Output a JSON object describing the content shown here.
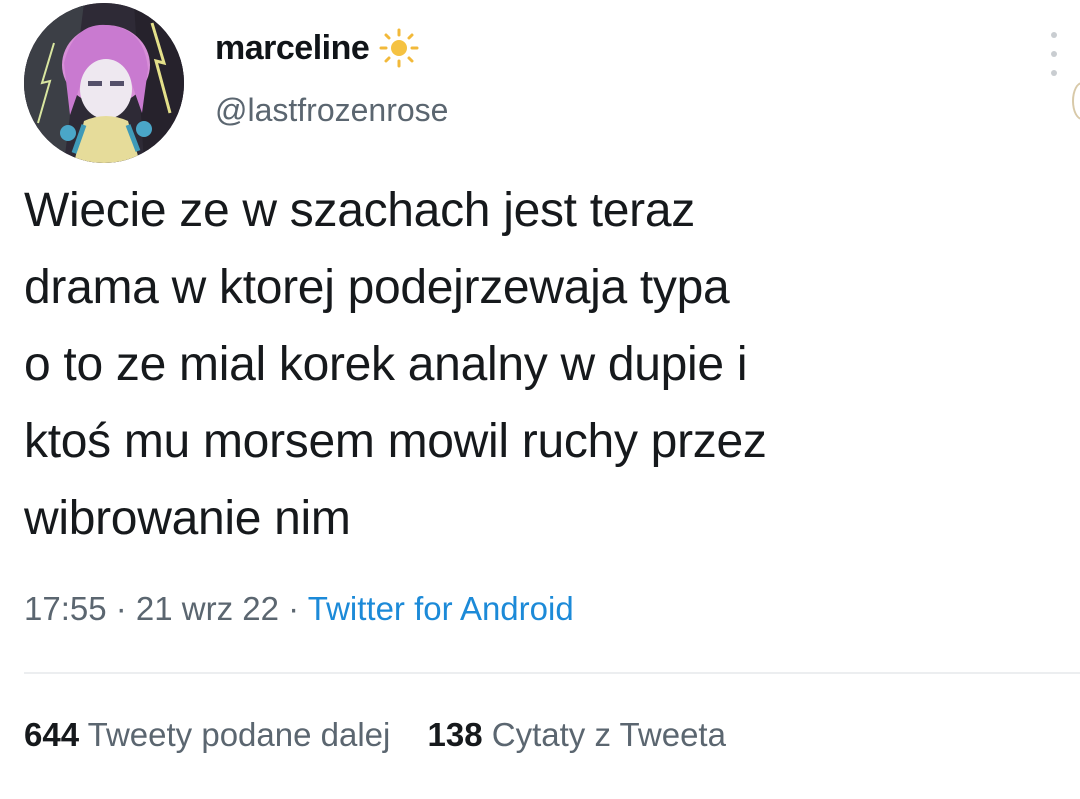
{
  "tweet": {
    "author": {
      "display_name": "marceline",
      "handle": "@lastfrozenrose",
      "badge_icon": "sun-icon",
      "avatar_icon": "avatar"
    },
    "text": "Wiecie ze w szachach jest teraz\ndrama w ktorej podejrzewaja typa\no to ze mial korek analny w dupie i\nktoś mu morsem mowil ruchy przez\nwibrowanie nim",
    "time": "17:55",
    "separator": " · ",
    "date": "21 wrz 22",
    "source": "Twitter for Android",
    "stats": {
      "retweets_count": "644",
      "retweets_label": "Tweety podane dalej",
      "quotes_count": "138",
      "quotes_label": "Cytaty z Tweeta"
    }
  },
  "colors": {
    "text": "#16191c",
    "secondary": "#5b6670",
    "link": "#1c8ad8",
    "background": "#ffffff"
  }
}
